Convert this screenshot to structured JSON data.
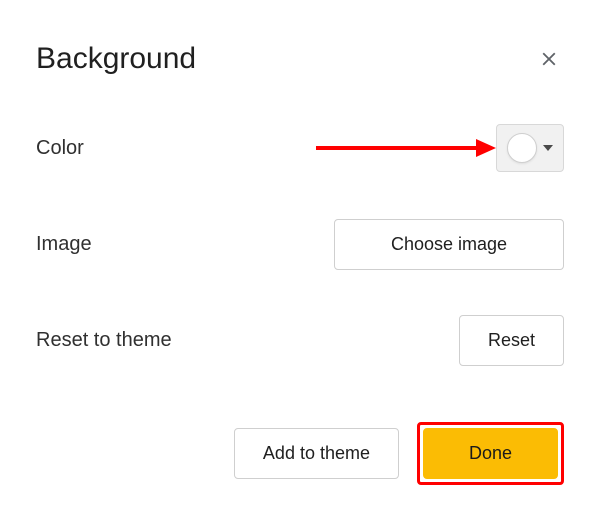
{
  "dialog": {
    "title": "Background"
  },
  "rows": {
    "color_label": "Color",
    "image_label": "Image",
    "choose_image_label": "Choose image",
    "reset_label": "Reset to theme",
    "reset_button_label": "Reset"
  },
  "footer": {
    "add_to_theme_label": "Add to theme",
    "done_label": "Done"
  },
  "color_picker": {
    "current_color": "#ffffff"
  },
  "annotation": {
    "arrow_color": "#ff0000",
    "highlight_color": "#ff0000"
  }
}
